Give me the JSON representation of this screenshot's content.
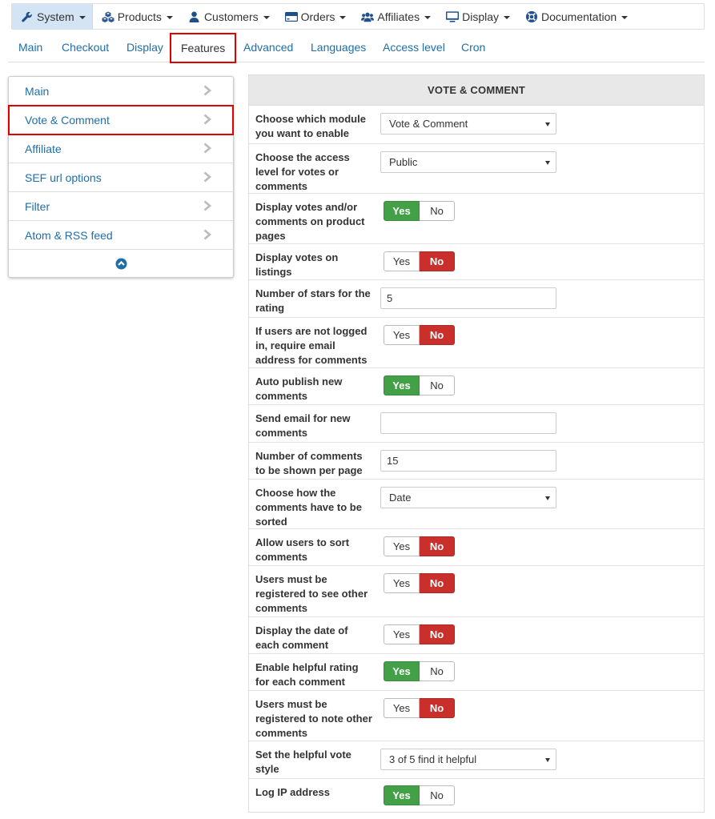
{
  "topmenu": [
    {
      "label": "System",
      "icon": "wrench-icon",
      "active": true
    },
    {
      "label": "Products",
      "icon": "cubes-icon",
      "active": false
    },
    {
      "label": "Customers",
      "icon": "user-icon",
      "active": false
    },
    {
      "label": "Orders",
      "icon": "credit-card-icon",
      "active": false
    },
    {
      "label": "Affiliates",
      "icon": "users-icon",
      "active": false
    },
    {
      "label": "Display",
      "icon": "desktop-icon",
      "active": false
    },
    {
      "label": "Documentation",
      "icon": "lifebuoy-icon",
      "active": false
    }
  ],
  "subtabs": [
    "Main",
    "Checkout",
    "Display",
    "Features",
    "Advanced",
    "Languages",
    "Access level",
    "Cron"
  ],
  "selected_subtab": "Features",
  "leftpanel": {
    "items": [
      "Main",
      "Vote & Comment",
      "Affiliate",
      "SEF url options",
      "Filter",
      "Atom & RSS feed"
    ],
    "selected": "Vote & Comment"
  },
  "config": {
    "title": "VOTE & COMMENT",
    "yes_label": "Yes",
    "no_label": "No",
    "rows": [
      {
        "label": "Choose which module you want to enable",
        "type": "select",
        "value": "Vote & Comment"
      },
      {
        "label": "Choose the access level for votes or comments",
        "type": "select",
        "value": "Public"
      },
      {
        "label": "Display votes and/or comments on product pages",
        "type": "toggle",
        "value": "Yes"
      },
      {
        "label": "Display votes on listings",
        "type": "toggle",
        "value": "No"
      },
      {
        "label": "Number of stars for the rating",
        "type": "text",
        "value": "5"
      },
      {
        "label": "If users are not logged in, require email address for comments",
        "type": "toggle",
        "value": "No"
      },
      {
        "label": "Auto publish new comments",
        "type": "toggle",
        "value": "Yes"
      },
      {
        "label": "Send email for new comments",
        "type": "text",
        "value": ""
      },
      {
        "label": "Number of comments to be shown per page",
        "type": "text",
        "value": "15"
      },
      {
        "label": "Choose how the comments have to be sorted",
        "type": "select",
        "value": "Date"
      },
      {
        "label": "Allow users to sort comments",
        "type": "toggle",
        "value": "No"
      },
      {
        "label": "Users must be registered to see other comments",
        "type": "toggle",
        "value": "No"
      },
      {
        "label": "Display the date of each comment",
        "type": "toggle",
        "value": "No"
      },
      {
        "label": "Enable helpful rating for each comment",
        "type": "toggle",
        "value": "Yes"
      },
      {
        "label": "Users must be registered to note other comments",
        "type": "toggle",
        "value": "No"
      },
      {
        "label": "Set the helpful vote style",
        "type": "select",
        "value": "3 of 5 find it helpful"
      },
      {
        "label": "Log IP address",
        "type": "toggle",
        "value": "Yes"
      }
    ]
  },
  "colors": {
    "link": "#1f6ea8",
    "yes_on": "#43a047",
    "no_on": "#c9302c",
    "highlight": "#e00000",
    "active_menu": "#d3e4f4"
  }
}
